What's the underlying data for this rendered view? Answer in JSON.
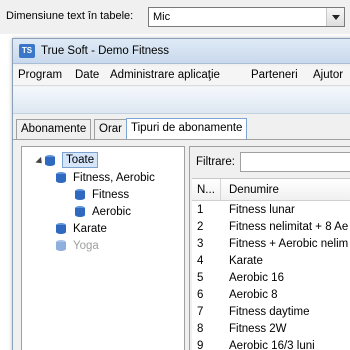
{
  "top": {
    "label": "Dimensiune text în tabele:",
    "selected": "Mic"
  },
  "window": {
    "icon_text": "TS",
    "title": "True Soft - Demo Fitness",
    "menu": [
      "Program",
      "Date",
      "Administrare aplicaţie",
      "Parteneri",
      "Ajutor"
    ],
    "tabs": [
      "Abonamente",
      "Orar",
      "Tipuri de abonamente"
    ],
    "active_tab": "Tipuri de abonamente"
  },
  "tree": {
    "root": "Toate",
    "nodes": [
      "Fitness, Aerobic",
      "Fitness",
      "Aerobic",
      "Karate",
      "Yoga"
    ],
    "disabled_nodes": [
      "Yoga"
    ]
  },
  "filter": {
    "label": "Filtrare:",
    "value": ""
  },
  "grid": {
    "columns": [
      "N...",
      "Denumire"
    ],
    "rows": [
      [
        "1",
        "Fitness lunar"
      ],
      [
        "2",
        "Fitness nelimitat + 8 Ae"
      ],
      [
        "3",
        "Fitness + Aerobic nelim"
      ],
      [
        "4",
        "Karate"
      ],
      [
        "5",
        "Aerobic 16"
      ],
      [
        "6",
        "Aerobic 8"
      ],
      [
        "7",
        "Fitness daytime"
      ],
      [
        "8",
        "Fitness 2W"
      ],
      [
        "9",
        "Aerobic 16/3 luni"
      ]
    ]
  },
  "colors": {
    "accent": "#3a77c9",
    "selection": "#d5e6fb",
    "disabled_text": "#a0a0a0"
  },
  "icons": [
    "db-stack-icon",
    "dropdown-arrow-icon",
    "app-icon",
    "expander-icon"
  ]
}
